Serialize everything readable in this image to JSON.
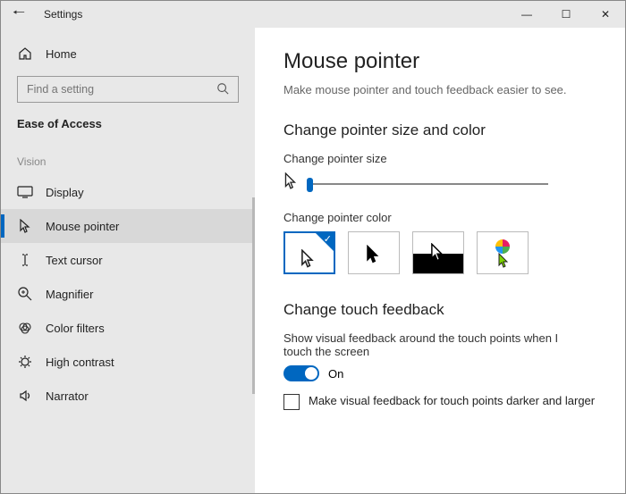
{
  "titlebar": {
    "title": "Settings",
    "back_aria": "Back"
  },
  "sidebar": {
    "home": "Home",
    "search_placeholder": "Find a setting",
    "category": "Ease of Access",
    "group": "Vision",
    "items": [
      {
        "label": "Display"
      },
      {
        "label": "Mouse pointer"
      },
      {
        "label": "Text cursor"
      },
      {
        "label": "Magnifier"
      },
      {
        "label": "Color filters"
      },
      {
        "label": "High contrast"
      },
      {
        "label": "Narrator"
      }
    ]
  },
  "main": {
    "title": "Mouse pointer",
    "subtitle": "Make mouse pointer and touch feedback easier to see.",
    "section1": "Change pointer size and color",
    "size_label": "Change pointer size",
    "color_label": "Change pointer color",
    "section2": "Change touch feedback",
    "touch_label": "Show visual feedback around the touch points when I touch the screen",
    "toggle_state": "On",
    "checkbox_label": "Make visual feedback for touch points darker and larger"
  }
}
